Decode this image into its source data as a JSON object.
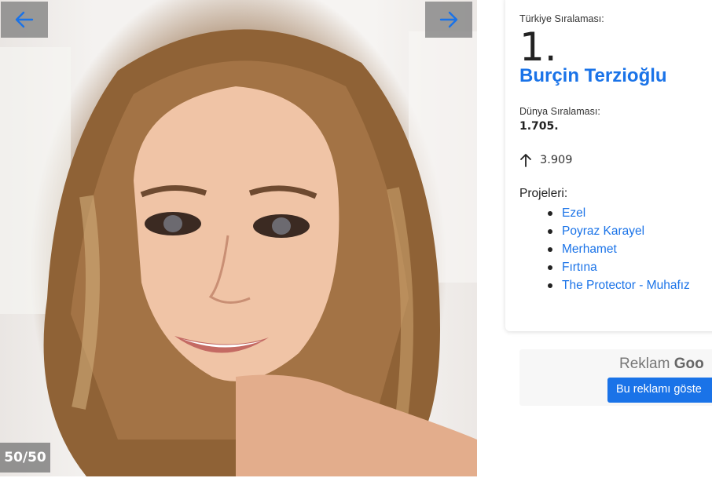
{
  "gallery": {
    "prev_icon": "arrow-left-icon",
    "next_icon": "arrow-right-icon",
    "counter": "50/50",
    "accent": "#1a73e8"
  },
  "profile": {
    "turkey_rank_label": "Türkiye Sıralaması:",
    "turkey_rank": "1.",
    "name": "Burçin Terzioğlu",
    "world_rank_label": "Dünya Sıralaması:",
    "world_rank": "1.705.",
    "trend_icon": "arrow-up-icon",
    "trend_value": "3.909",
    "projects_label": "Projeleri:",
    "projects": [
      "Ezel",
      "Poyraz Karayel",
      "Merhamet",
      "Fırtına",
      "The Protector - Muhafız"
    ]
  },
  "ad": {
    "label_prefix": "Reklam",
    "label_brand": "Goo",
    "button": "Bu reklamı göste"
  }
}
